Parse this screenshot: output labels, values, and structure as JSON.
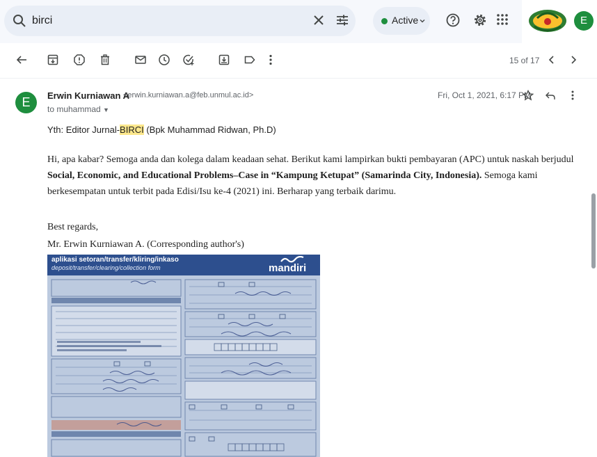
{
  "search": {
    "query": "birci"
  },
  "status": {
    "label": "Active"
  },
  "account": {
    "initial": "E"
  },
  "toolbar": {
    "pager": "15 of 17"
  },
  "message": {
    "sender_initial": "E",
    "sender_name": "Erwin Kurniawan A",
    "sender_email": "<erwin.kurniawan.a@feb.unmul.ac.id>",
    "to": "to muhammad",
    "date": "Fri, Oct 1, 2021, 6:17 PM",
    "greeting_pre": "Yth: Editor Jurnal-",
    "greeting_highlight": "BIRCI",
    "greeting_post": " (Bpk Muhammad Ridwan, Ph.D)",
    "body_pre": "Hi, apa kabar? Semoga anda dan kolega dalam keadaan sehat. Berikut kami lampirkan bukti pembayaran (APC) untuk naskah berjudul ",
    "body_title": "Social, Economic, and Educational Problems–Case in “Kampung Ketupat” (Samarinda City, Indonesia).",
    "body_post": " Semoga kami berkesempatan untuk terbit pada Edisi/Isu ke-4 (2021) ini. Berharap yang terbaik darimu.",
    "regards": "Best regards,",
    "signature": "Mr. Erwin Kurniawan A. (Corresponding author's)"
  },
  "attachment": {
    "title1": "aplikasi setoran/transfer/kliring/inkaso",
    "title2": "deposit/transfer/clearing/collection form",
    "brand": "mandiri"
  },
  "colors": {
    "accent_green": "#1e8e3e",
    "highlight": "#fce78c",
    "receipt_blue": "#2d4f8e"
  }
}
